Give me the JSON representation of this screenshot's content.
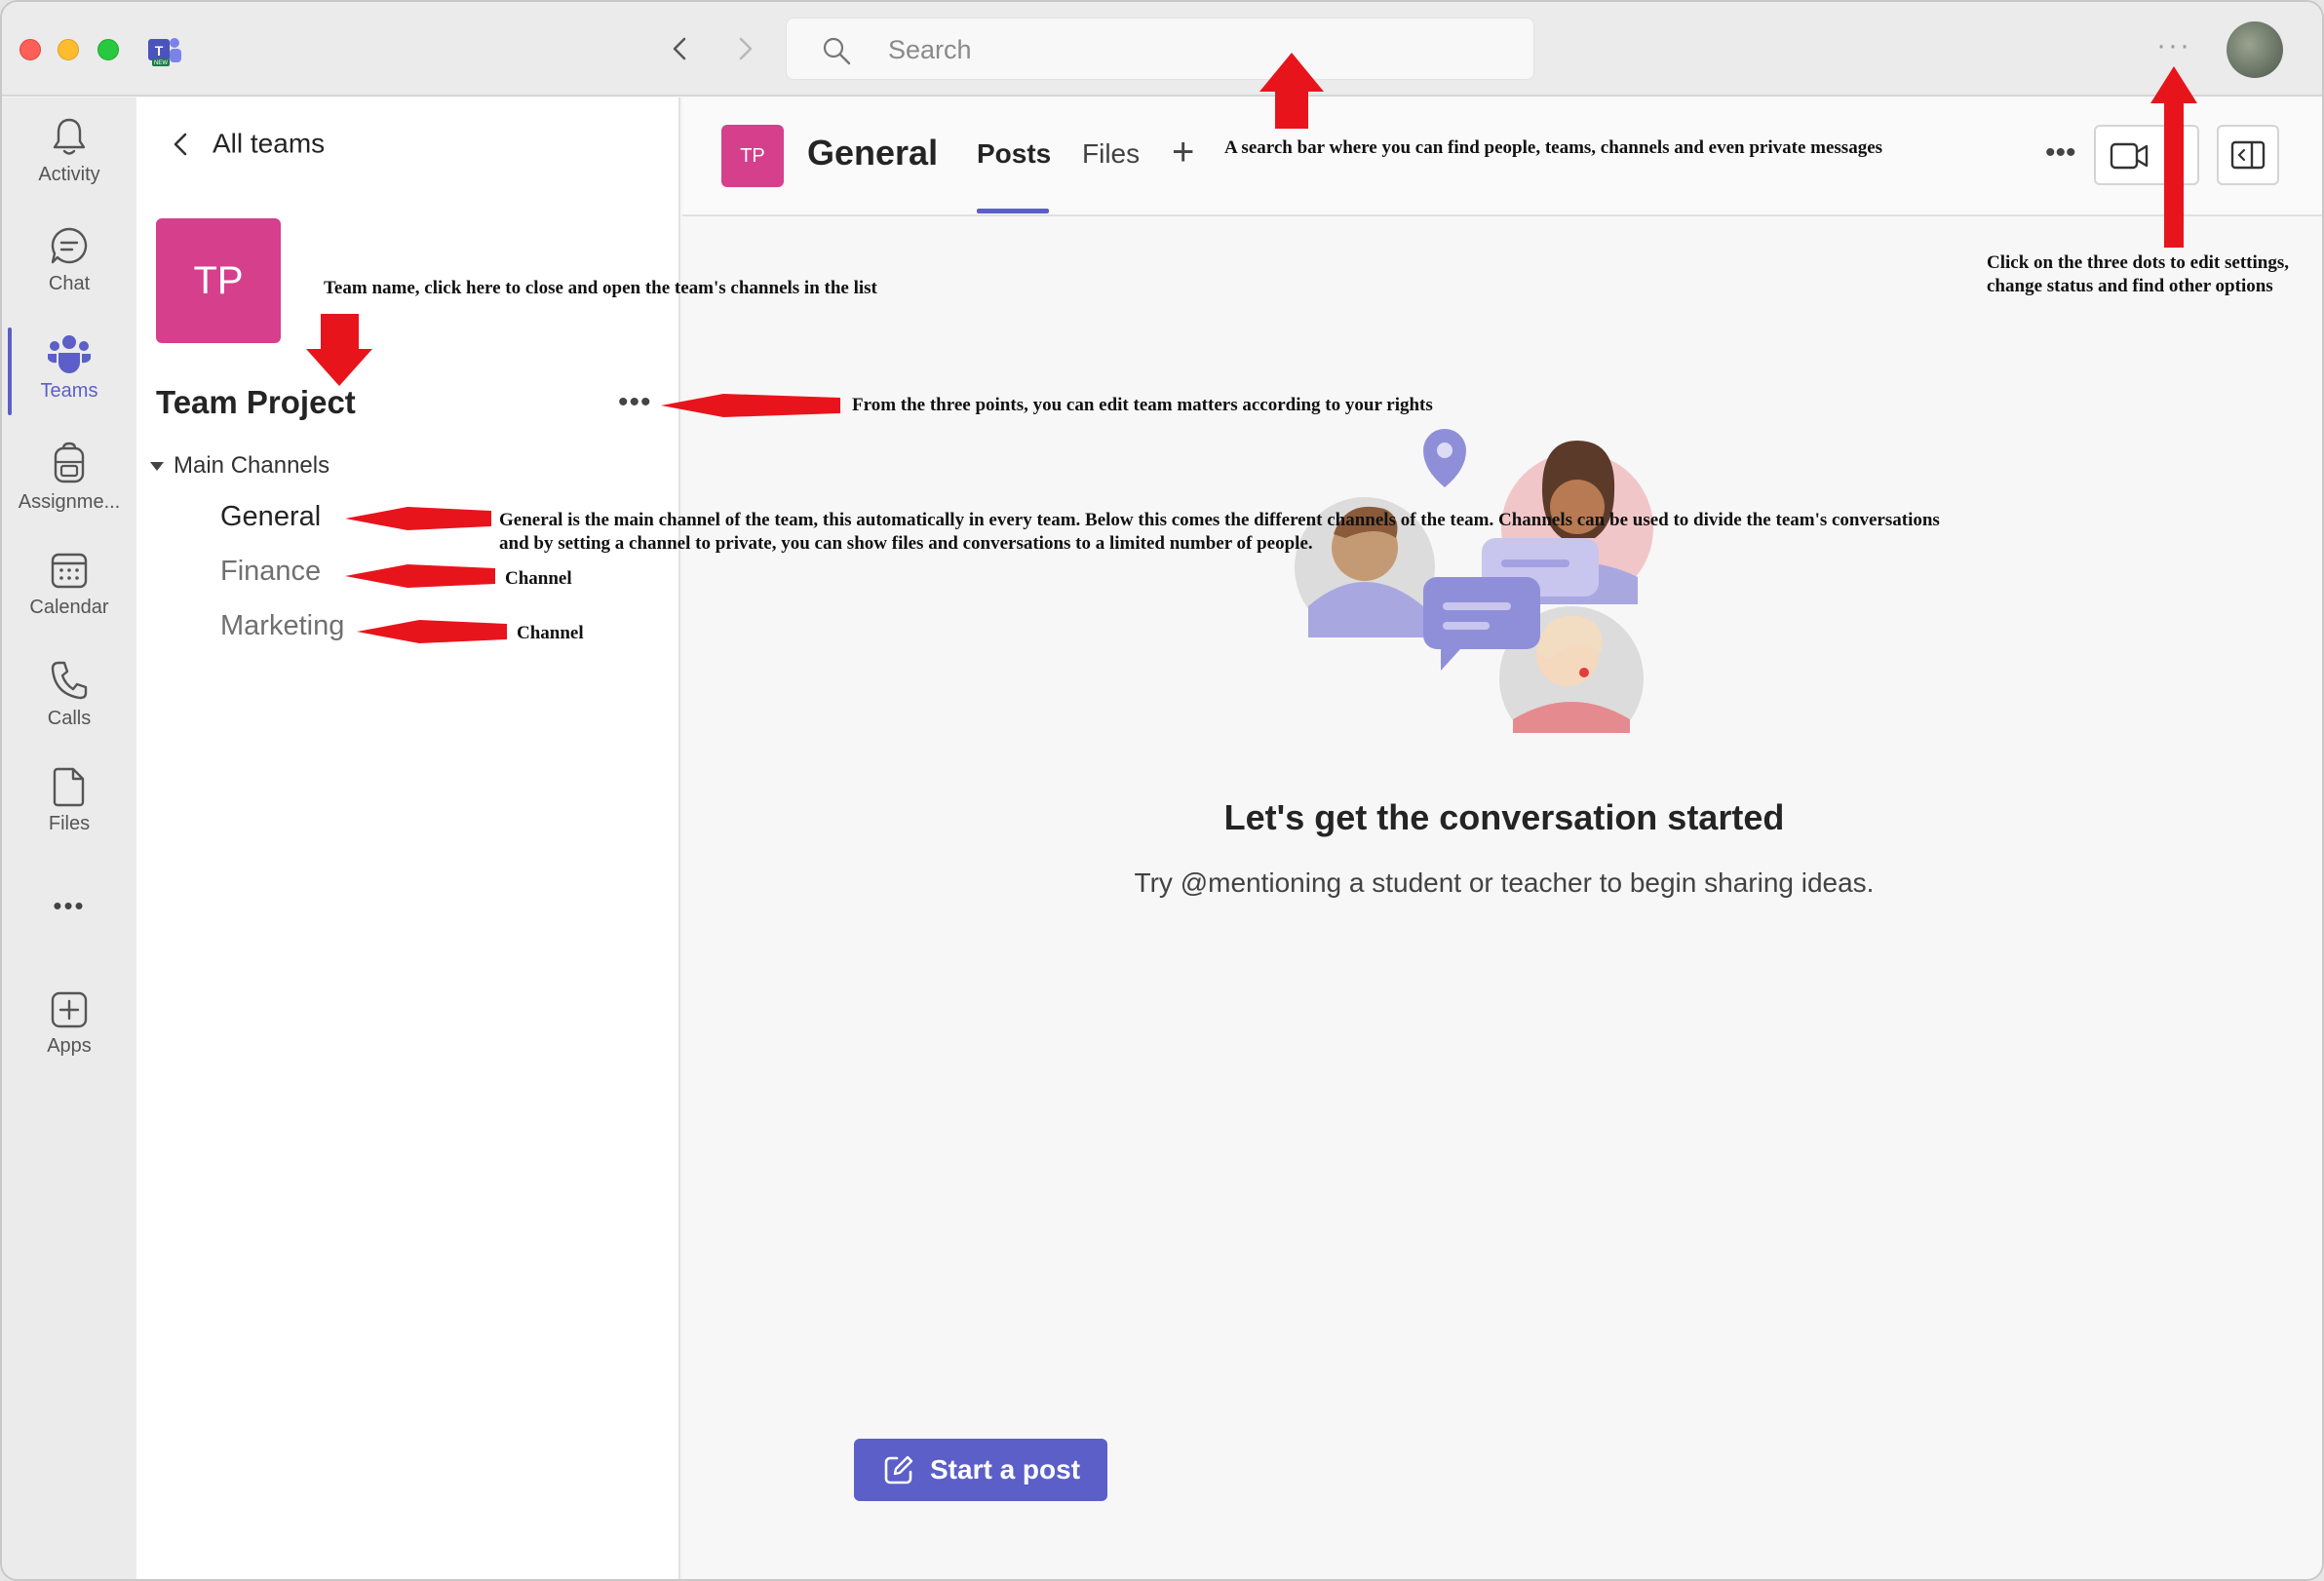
{
  "titlebar": {
    "search_placeholder": "Search",
    "more_label": "···"
  },
  "rail": {
    "items": [
      {
        "label": "Activity",
        "icon": "bell-icon"
      },
      {
        "label": "Chat",
        "icon": "chat-icon"
      },
      {
        "label": "Teams",
        "icon": "teams-icon"
      },
      {
        "label": "Assignme...",
        "icon": "backpack-icon"
      },
      {
        "label": "Calendar",
        "icon": "calendar-icon"
      },
      {
        "label": "Calls",
        "icon": "phone-icon"
      },
      {
        "label": "Files",
        "icon": "file-icon"
      },
      {
        "label": "•••",
        "icon": "more-icon"
      },
      {
        "label": "Apps",
        "icon": "plus-square-icon"
      }
    ],
    "active": "Teams"
  },
  "team_panel": {
    "back_label": "All teams",
    "team_initials": "TP",
    "team_name": "Team Project",
    "team_dots": "•••",
    "section": "Main Channels",
    "channels": [
      "General",
      "Finance",
      "Marketing"
    ],
    "active_channel": "General"
  },
  "main": {
    "channel_initials": "TP",
    "channel_title": "General",
    "tabs": [
      "Posts",
      "Files"
    ],
    "active_tab": "Posts",
    "dots": "•••",
    "empty_title": "Let's get the conversation started",
    "empty_subtitle": "Try @mentioning a student or teacher to begin sharing ideas.",
    "start_post": "Start a post"
  },
  "annotations": {
    "search": "A search bar where you can find people, teams, channels and even private messages",
    "settings": "Click on the three dots to edit settings, change status and find other options",
    "team_name": "Team name, click here to close and open the team's channels in the list",
    "team_dots": "From the three points, you can edit team matters according to your rights",
    "general": "General is the main channel of the team, this automatically in every team. Below this comes the different channels of the team. Channels can be used to divide the team's conversations and by setting a channel to private, you can show files and conversations to a limited number of people.",
    "finance": "Channel",
    "marketing": "Channel"
  },
  "colors": {
    "accent": "#5b5fc7",
    "team_tile": "#d53f8c",
    "annotation_arrow": "#e8141c"
  }
}
